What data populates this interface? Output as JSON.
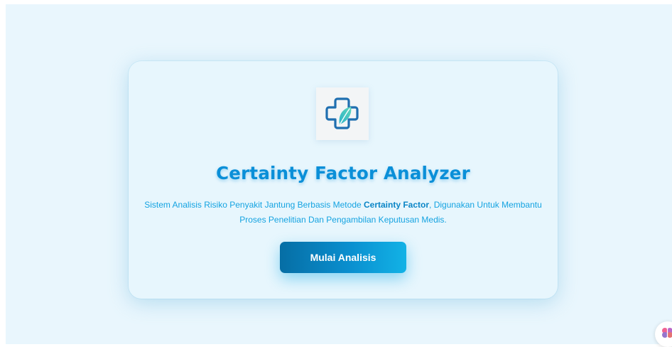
{
  "hero": {
    "logo_icon": "medical-cross-leaf-icon",
    "title": "Certainty Factor Analyzer",
    "description_before": "Sistem Analisis Risiko Penyakit Jantung Berbasis Metode ",
    "description_bold": "Certainty Factor",
    "description_after": ", Digunakan Untuk Membantu Proses Penelitian Dan Pengambilan Keputusan Medis.",
    "cta_label": "Mulai Analisis"
  },
  "floating_button": {
    "icon": "brain-icon"
  },
  "colors": {
    "page_background": "#e9f6fd",
    "card_background": "#e7f6fd",
    "title": "#0a8fd8",
    "text": "#14a3e1",
    "button_start": "#066ea5",
    "button_end": "#12b2e6"
  }
}
